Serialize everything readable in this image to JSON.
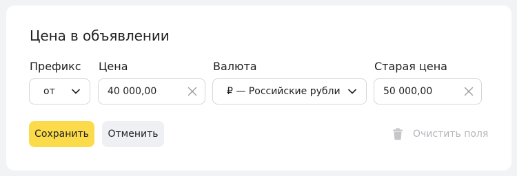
{
  "form": {
    "title": "Цена в объявлении",
    "prefix": {
      "label": "Префикс",
      "value": "от"
    },
    "price": {
      "label": "Цена",
      "value": "40 000,00"
    },
    "currency": {
      "label": "Валюта",
      "value": "₽ — Российские рубли"
    },
    "old_price": {
      "label": "Старая цена",
      "value": "50 000,00"
    }
  },
  "actions": {
    "save_label": "Сохранить",
    "cancel_label": "Отменить",
    "clear_label": "Очистить поля"
  },
  "colors": {
    "accent": "#fcdb4b",
    "secondary_button": "#eef0f3",
    "disabled_text": "#b4b6ba",
    "page_bg": "#f2f3f5"
  },
  "icons": [
    "chevron-down-icon",
    "close-icon",
    "trash-icon"
  ]
}
